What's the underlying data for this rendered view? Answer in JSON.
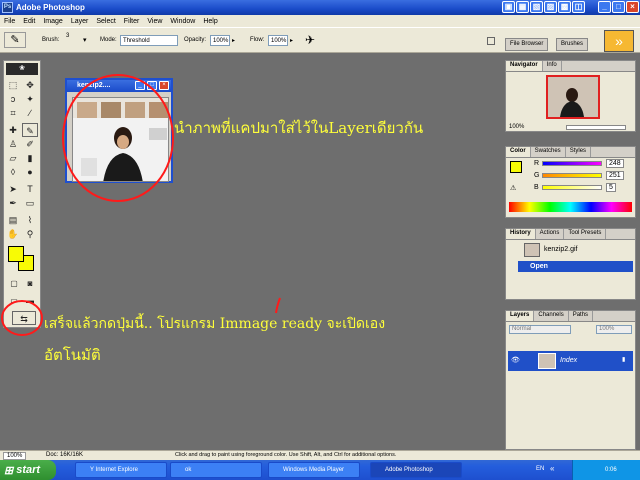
{
  "app": {
    "title": "Adobe Photoshop"
  },
  "menu": [
    "File",
    "Edit",
    "Image",
    "Layer",
    "Select",
    "Filter",
    "View",
    "Window",
    "Help"
  ],
  "options": {
    "brush_label": "Brush:",
    "brush_size": "3",
    "mode_label": "Mode:",
    "mode_value": "Threshold",
    "opacity_label": "Opacity:",
    "opacity_value": "100%",
    "flow_label": "Flow:",
    "flow_value": "100%",
    "well_tabs": [
      "File Browser",
      "Brushes"
    ]
  },
  "document": {
    "title": "kenzip2...."
  },
  "annotations": {
    "top": "นำภาพที่แคปมาใส่ไว้ในLayerเดียวกัน",
    "bottom_line1": "เสร็จแล้วกดปุ่มนี้.. โปรแกรม Immage ready จะเปิดเอง",
    "bottom_line2": "อัตโนมัติ"
  },
  "navigator": {
    "tabs": [
      "Navigator",
      "Info"
    ],
    "zoom": "100%"
  },
  "color": {
    "tabs": [
      "Color",
      "Swatches",
      "Styles"
    ],
    "r_label": "R",
    "g_label": "G",
    "b_label": "B",
    "r": "248",
    "g": "251",
    "b": "5",
    "fg_color": "#f8fb05"
  },
  "history": {
    "tabs": [
      "History",
      "Actions",
      "Tool Presets"
    ],
    "snapshot": "kenzip2.gif",
    "step": "Open"
  },
  "layers": {
    "tabs": [
      "Layers",
      "Channels",
      "Paths"
    ],
    "blend": "Normal",
    "opacity": "100%",
    "layer_name": "Index"
  },
  "status": {
    "zoom": "100%",
    "doc": "Doc: 16K/16K",
    "hint": "Click and drag to paint using foreground color. Use Shift, Alt, and Ctrl for additional options."
  },
  "taskbar": {
    "start": "start",
    "tasks": [
      "Y Internet Explore",
      "ok",
      "Windows Media Player",
      "Adobe Photoshop"
    ],
    "lang": "EN",
    "clock": "0:06"
  }
}
